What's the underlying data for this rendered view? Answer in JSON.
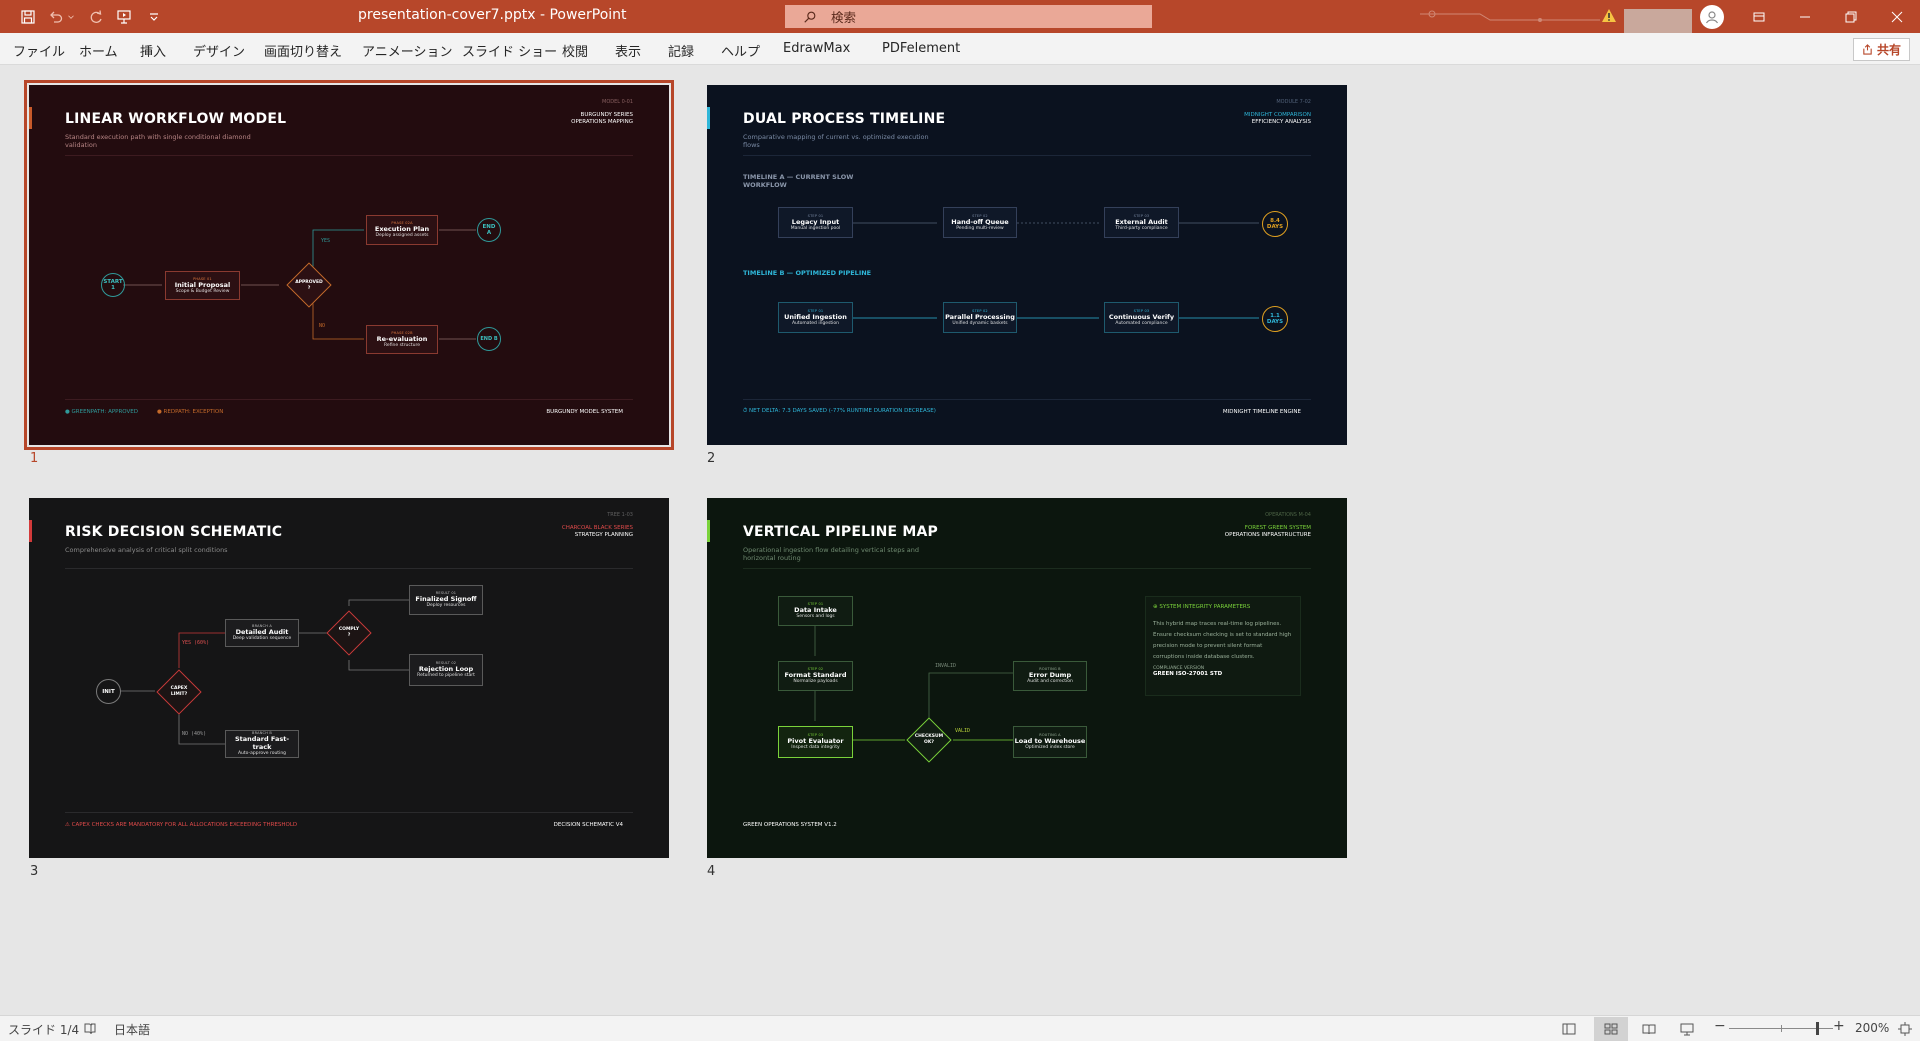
{
  "window": {
    "title": "presentation-cover7.pptx  -  PowerPoint",
    "search_placeholder": "検索",
    "colors": {
      "accent": "#b7472a"
    }
  },
  "ribbon": {
    "tabs": [
      "ファイル",
      "ホーム",
      "挿入",
      "デザイン",
      "画面切り替え",
      "アニメーション",
      "スライド ショー",
      "校閲",
      "表示",
      "記録",
      "ヘルプ",
      "EdrawMax",
      "PDFelement"
    ],
    "share_label": "共有"
  },
  "slides": [
    {
      "number": "1",
      "title": "LINEAR WORKFLOW MODEL",
      "subtitle": "Standard execution path with single conditional diamond validation",
      "meta": "MODEL 0-01",
      "tag1": "BURGUNDY SERIES",
      "tag2": "OPERATIONS MAPPING",
      "footer_left_a": "● GREENPATH: APPROVED",
      "footer_left_b": "● REDPATH: EXCEPTION",
      "footer_right": "BURGUNDY MODEL SYSTEM",
      "start": "START\n1",
      "n1_k": "PHASE 01",
      "n1_t": "Initial Proposal",
      "n1_d": "Scope & Budget Review",
      "decision": "APPROVED\n?",
      "yes": "YES",
      "no": "NO",
      "n2_k": "PHASE 02A",
      "n2_t": "Execution Plan",
      "n2_d": "Deploy assigned assets",
      "n3_k": "PHASE 02B",
      "n3_t": "Re-evaluation",
      "n3_d": "Refine structure",
      "end_a": "END\nA",
      "end_b": "END B"
    },
    {
      "number": "2",
      "title": "DUAL PROCESS TIMELINE",
      "subtitle": "Comparative mapping of current vs. optimized execution flows",
      "meta": "MODULE 7-02",
      "tag1": "MIDNIGHT COMPARISON",
      "tag2": "EFFICIENCY ANALYSIS",
      "section_a": "TIMELINE A — CURRENT SLOW WORKFLOW",
      "section_b": "TIMELINE B — OPTIMIZED PIPELINE",
      "a1_k": "STEP 01",
      "a1_t": "Legacy Input",
      "a1_d": "Manual ingestion pool",
      "a2_k": "STEP 02",
      "a2_t": "Hand-off Queue",
      "a2_d": "Pending multi-review",
      "a3_k": "STEP 03",
      "a3_t": "External Audit",
      "a3_d": "Third-party compliance",
      "a_end": "8.4\nDAYS",
      "b1_k": "STEP 01",
      "b1_t": "Unified Ingestion",
      "b1_d": "Automated ingestion",
      "b2_k": "STEP 02",
      "b2_t": "Parallel Processing",
      "b2_d": "Unified dynamic baskets",
      "b3_k": "STEP 03",
      "b3_t": "Continuous Verify",
      "b3_d": "Automated compliance",
      "b_end": "1.1\nDAYS",
      "footer_left": "⏱ NET DELTA: 7.3 DAYS SAVED (-77% RUNTIME DURATION DECREASE)",
      "footer_right": "MIDNIGHT TIMELINE ENGINE"
    },
    {
      "number": "3",
      "title": "RISK DECISION SCHEMATIC",
      "subtitle": "Comprehensive analysis of critical split conditions",
      "meta": "TREE 1-03",
      "tag1": "CHARCOAL BLACK SERIES",
      "tag2": "STRATEGY PLANNING",
      "init": "INIT",
      "d1": "CAPEX\nLIMIT?",
      "yes": "YES (60%)",
      "no": "NO (40%)",
      "n1_k": "BRANCH A",
      "n1_t": "Detailed Audit",
      "n1_d": "Deep validation sequence",
      "n2_k": "BRANCH B",
      "n2_t": "Standard Fast-track",
      "n2_d": "Auto-approve routing",
      "d2": "COMPLY\n?",
      "r1_k": "RESULT 01",
      "r1_t": "Finalized Signoff",
      "r1_d": "Deploy resources",
      "r2_k": "RESULT 02",
      "r2_t": "Rejection Loop",
      "r2_d": "Returned to pipeline start",
      "footer_left": "⚠ CAPEX CHECKS ARE MANDATORY FOR ALL ALLOCATIONS EXCEEDING THRESHOLD",
      "footer_right": "DECISION SCHEMATIC V4"
    },
    {
      "number": "4",
      "title": "VERTICAL PIPELINE MAP",
      "subtitle": "Operational ingestion flow detailing vertical steps and horizontal routing",
      "meta": "OPERATIONS M-04",
      "tag1": "FOREST GREEN SYSTEM",
      "tag2": "OPERATIONS INFRASTRUCTURE",
      "s1_k": "STEP 01",
      "s1_t": "Data Intake",
      "s1_d": "Sensors and logs",
      "s2_k": "STEP 02",
      "s2_t": "Format Standard",
      "s2_d": "Normalize payloads",
      "s3_k": "STEP 03",
      "s3_t": "Pivot Evaluator",
      "s3_d": "Inspect data integrity",
      "d": "CHECKSUM\nOK?",
      "invalid": "INVALID",
      "valid": "VALID",
      "r1_k": "ROUTING B",
      "r1_t": "Error Dump",
      "r1_d": "Audit and correction",
      "r2_k": "ROUTING A",
      "r2_t": "Load to Warehouse",
      "r2_d": "Optimized index store",
      "panel_title": "⊕ SYSTEM INTEGRITY PARAMETERS",
      "panel_body": "This hybrid map traces real-time log pipelines. Ensure checksum checking is set to standard high precision mode to prevent silent format corruptions inside database clusters.",
      "panel_k": "COMPLIANCE VERSION",
      "panel_v": "GREEN ISO-27001 STD",
      "footer_left": "GREEN OPERATIONS SYSTEM V1.2"
    }
  ],
  "statusbar": {
    "slide_indicator": "スライド 1/4",
    "language": "日本語",
    "zoom": "200%",
    "zoom_level": 0.85
  }
}
